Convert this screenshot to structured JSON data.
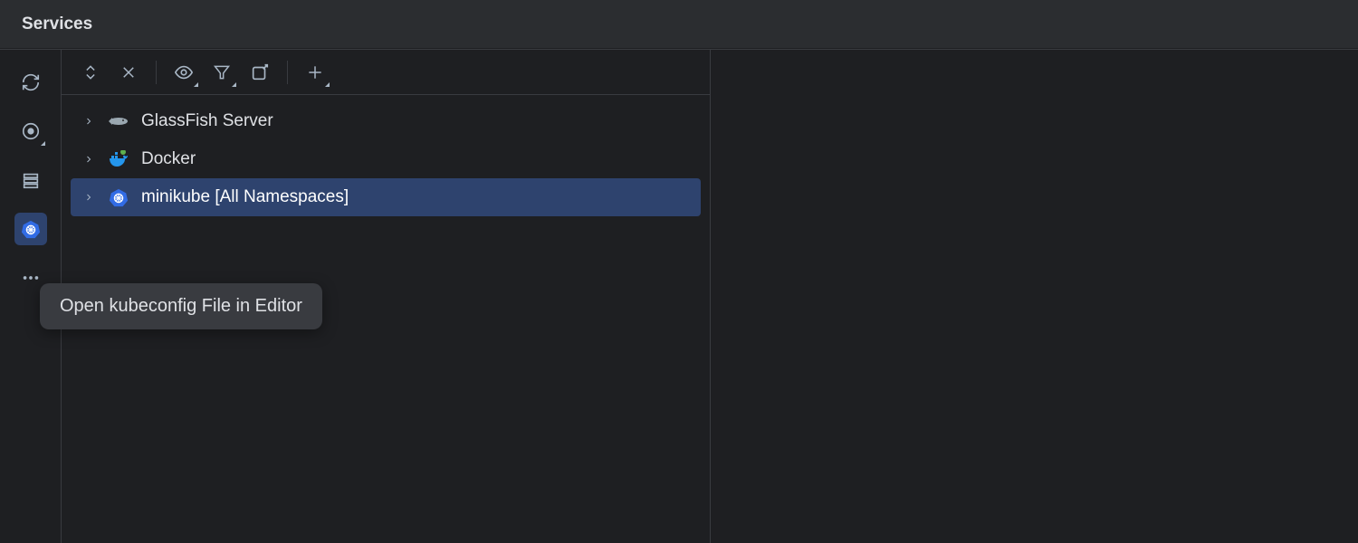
{
  "header": {
    "title": "Services"
  },
  "rail": {
    "items": [
      {
        "name": "sync-icon",
        "active": false
      },
      {
        "name": "target-icon",
        "active": false
      },
      {
        "name": "database-icon",
        "active": false
      },
      {
        "name": "kubernetes-icon",
        "active": true
      },
      {
        "name": "more-icon",
        "active": false
      }
    ]
  },
  "toolbar": {
    "items": [
      {
        "name": "expand-collapse-icon"
      },
      {
        "name": "close-icon"
      },
      {
        "sep": true
      },
      {
        "name": "eye-icon"
      },
      {
        "name": "filter-icon"
      },
      {
        "name": "open-new-window-icon"
      },
      {
        "sep": true
      },
      {
        "name": "add-icon"
      }
    ]
  },
  "tree": {
    "nodes": [
      {
        "label": "GlassFish Server",
        "icon": "glassfish-icon",
        "selected": false
      },
      {
        "label": "Docker",
        "icon": "docker-icon",
        "selected": false
      },
      {
        "label": "minikube [All Namespaces]",
        "icon": "kubernetes-node-icon",
        "selected": true
      }
    ]
  },
  "popup": {
    "label": "Open kubeconfig File in Editor"
  }
}
